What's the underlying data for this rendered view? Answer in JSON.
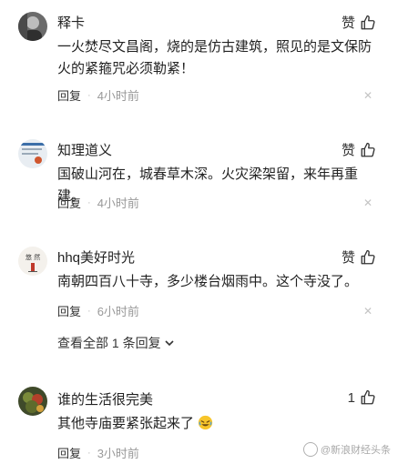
{
  "comments": [
    {
      "username": "释卡",
      "content": "一火焚尽文昌阁，烧的是仿古建筑，照见的是文保防火的紧箍咒必须勒紧！",
      "like_label": "赞",
      "reply_label": "回复",
      "time": "4小时前"
    },
    {
      "username": "知理道义",
      "content": "国破山河在，城春草木深。火灾梁架留，来年再重建。",
      "like_label": "赞",
      "reply_label": "回复",
      "time": "4小时前"
    },
    {
      "username": "hhq美好时光",
      "content": "南朝四百八十寺，多少楼台烟雨中。这个寺没了。",
      "like_label": "赞",
      "reply_label": "回复",
      "time": "6小时前",
      "avatar_text": "悠 然"
    },
    {
      "username": "谁的生活很完美",
      "content": "其他寺庙要紧张起来了",
      "like_label": "1",
      "reply_label": "回复",
      "time": "3小时前"
    }
  ],
  "view_all_replies": "查看全部 1 条回复",
  "watermark": "@新浪财经头条",
  "icons": {
    "like": "thumbs-up-icon",
    "close": "close-icon",
    "expand": "chevron-down-icon",
    "emoji": "laughing-emoji-icon"
  },
  "colors": {
    "text": "#222222",
    "meta": "#999999",
    "close": "#c4c4c4"
  }
}
